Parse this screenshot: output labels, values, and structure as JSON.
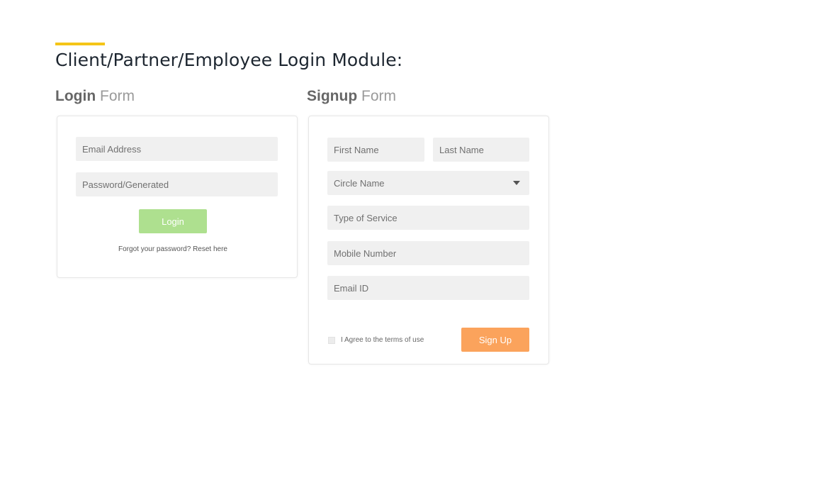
{
  "page": {
    "title": "Client/Partner/Employee Login Module:"
  },
  "colors": {
    "accent": "#f5c518",
    "login_button": "#aee08f",
    "signup_button": "#fba35c"
  },
  "login": {
    "heading_strong": "Login",
    "heading_light": "Form",
    "email_placeholder": "Email Address",
    "password_placeholder": "Password/Generated",
    "submit_label": "Login",
    "forgot_text": "Forgot your password? Reset here"
  },
  "signup": {
    "heading_strong": "Signup",
    "heading_light": "Form",
    "first_name_placeholder": "First Name",
    "last_name_placeholder": "Last Name",
    "circle_placeholder": "Circle Name",
    "service_placeholder": "Type of Service",
    "mobile_placeholder": "Mobile Number",
    "email_placeholder": "Email ID",
    "agree_text": "I Agree to the terms of use",
    "agree_checked": false,
    "submit_label": "Sign Up"
  }
}
